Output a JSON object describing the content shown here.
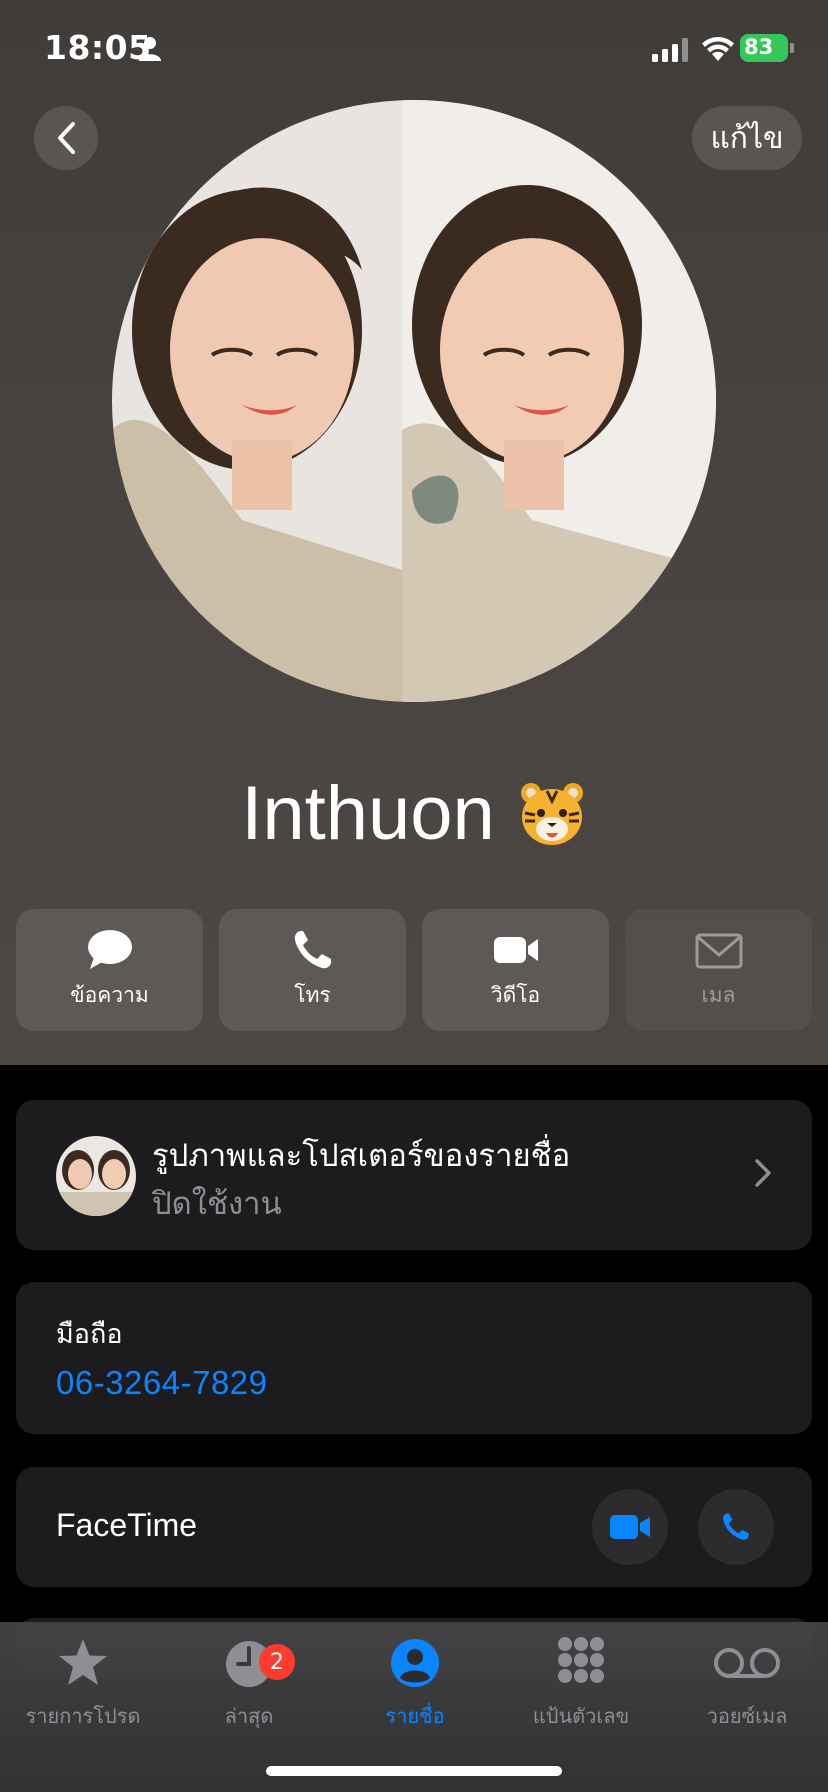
{
  "status_bar": {
    "time": "18:05",
    "battery": "83"
  },
  "header": {
    "edit_label": "แก้ไข"
  },
  "contact": {
    "name": "Inthuon"
  },
  "actions": [
    {
      "label": "ข้อความ"
    },
    {
      "label": "โทร"
    },
    {
      "label": "วิดีโอ"
    },
    {
      "label": "เมล"
    }
  ],
  "poster": {
    "title": "รูปภาพและโปสเตอร์ของรายชื่อ",
    "subtitle": "ปิดใช้งาน"
  },
  "phone": {
    "label": "มือถือ",
    "number": "06-3264-7829"
  },
  "facetime": {
    "label": "FaceTime"
  },
  "tabbar": {
    "tabs": [
      {
        "label": "รายการโปรด"
      },
      {
        "label": "ล่าสุด",
        "badge": "2"
      },
      {
        "label": "รายชื่อ"
      },
      {
        "label": "แป้นตัวเลข"
      },
      {
        "label": "วอยซ์เมล"
      }
    ]
  },
  "colors": {
    "accent": "#0a84ff",
    "battery": "#34c759",
    "badge": "#ff3b30"
  }
}
